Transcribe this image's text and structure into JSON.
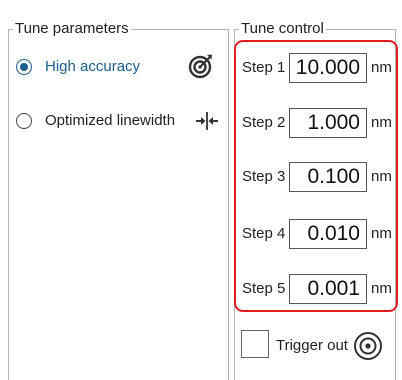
{
  "tune_parameters": {
    "title": "Tune parameters",
    "options": [
      {
        "label": "High accuracy",
        "selected": true,
        "icon": "target-icon"
      },
      {
        "label": "Optimized linewidth",
        "selected": false,
        "icon": "arrows-inward-icon"
      }
    ]
  },
  "tune_control": {
    "title": "Tune control",
    "steps": [
      {
        "label": "Step 1",
        "value": "10.000",
        "unit": "nm"
      },
      {
        "label": "Step 2",
        "value": "1.000",
        "unit": "nm"
      },
      {
        "label": "Step 3",
        "value": "0.100",
        "unit": "nm"
      },
      {
        "label": "Step 4",
        "value": "0.010",
        "unit": "nm"
      },
      {
        "label": "Step 5",
        "value": "0.001",
        "unit": "nm"
      }
    ],
    "trigger": {
      "label": "Trigger out",
      "checked": false,
      "icon": "concentric-circles-icon"
    },
    "highlight_color": "#e02020"
  },
  "accent_color": "#1a5e8a"
}
